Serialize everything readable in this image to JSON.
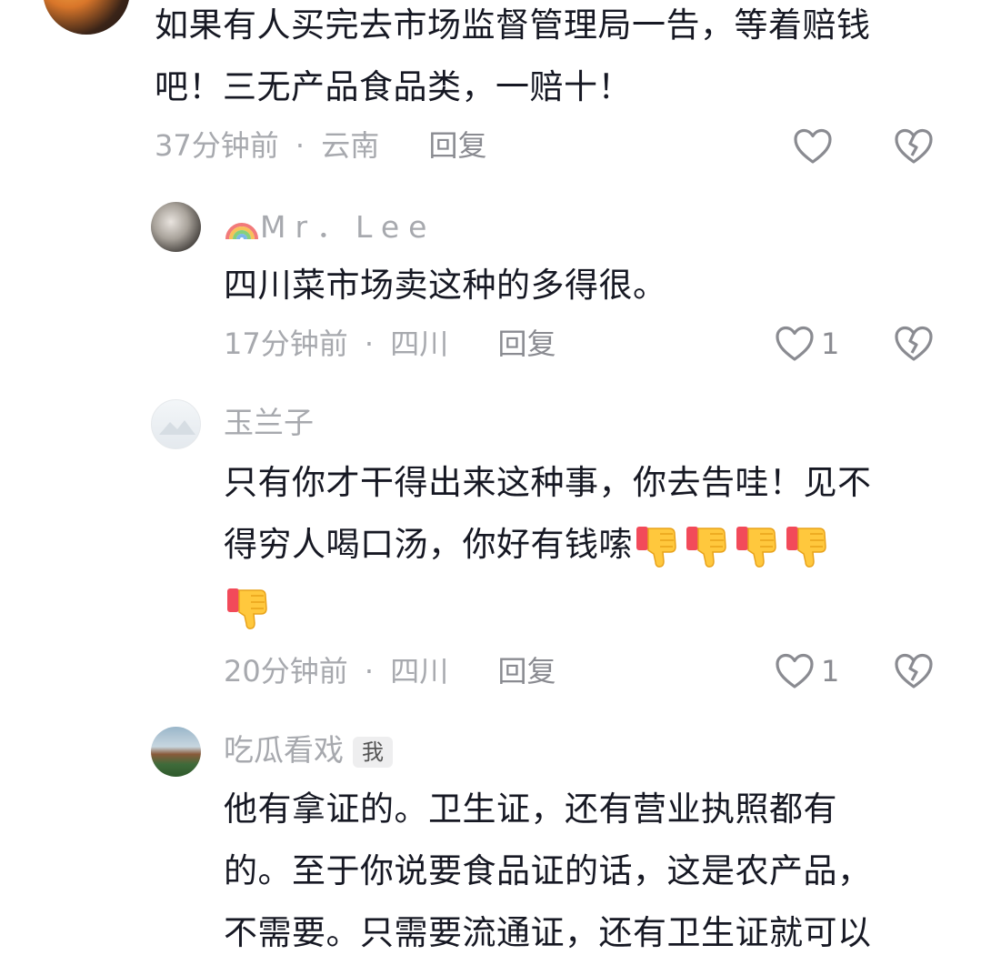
{
  "comments": [
    {
      "id": "top",
      "text_lines": [
        "如果有人买完去市场监督管理局一告，等着赔钱",
        "吧！三无产品食品类，一赔十！"
      ],
      "time": "37分钟前",
      "separator": "·",
      "location": "云南",
      "reply_label": "回复",
      "likes": ""
    },
    {
      "id": "lee",
      "name": "Mr．Lee",
      "name_prefix_icon": "rainbow-icon",
      "text_lines": [
        "四川菜市场卖这种的多得很。"
      ],
      "time": "17分钟前",
      "separator": "·",
      "location": "四川",
      "reply_label": "回复",
      "likes": "1"
    },
    {
      "id": "yulanzi",
      "name": "玉兰子",
      "text_lines": [
        "只有你才干得出来这种事，你去告哇！见不",
        "得穷人喝口汤，你好有钱嗦"
      ],
      "emoji": "thumbs-down-icon",
      "emoji_count": 5,
      "time": "20分钟前",
      "separator": "·",
      "location": "四川",
      "reply_label": "回复",
      "likes": "1"
    },
    {
      "id": "me",
      "name": "吃瓜看戏",
      "badge": "我",
      "text_lines": [
        "他有拿证的。卫生证，还有营业执照都有",
        "的。至于你说要食品证的话，这是农产品，",
        "不需要。只需要流通证，还有卫生证就可以"
      ]
    }
  ],
  "colors": {
    "text": "#161823",
    "meta": "#a7a9ae",
    "icon": "#8a8b91"
  }
}
